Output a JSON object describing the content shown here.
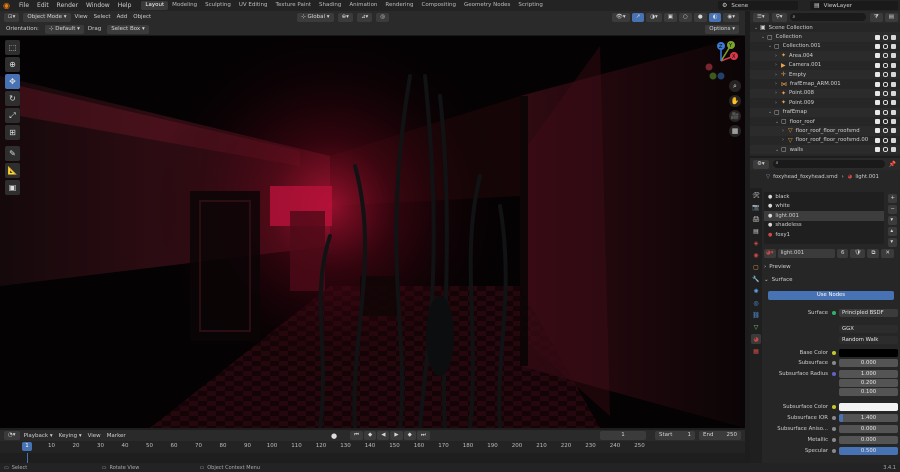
{
  "topbar": {
    "menus": [
      "File",
      "Edit",
      "Render",
      "Window",
      "Help"
    ],
    "workspaces": [
      "Layout",
      "Modeling",
      "Sculpting",
      "UV Editing",
      "Texture Paint",
      "Shading",
      "Animation",
      "Rendering",
      "Compositing",
      "Geometry Nodes",
      "Scripting"
    ],
    "active_workspace": "Layout",
    "scene": "Scene",
    "view_layer": "ViewLayer"
  },
  "viewport_header": {
    "mode": "Object Mode",
    "menus": [
      "View",
      "Select",
      "Add",
      "Object"
    ],
    "transform": "Global",
    "orientation_label": "Orientation:",
    "orientation_value": "Default",
    "drag_label": "Drag",
    "drag_value": "Select Box",
    "options": "Options"
  },
  "gizmo": {
    "x": "X",
    "y": "Y",
    "z": "Z"
  },
  "timeline": {
    "menus": [
      "Playback",
      "Keying",
      "View",
      "Marker"
    ],
    "current_frame": "1",
    "start_label": "Start",
    "start": "1",
    "end_label": "End",
    "end": "250",
    "ticks": [
      "0",
      "10",
      "20",
      "30",
      "40",
      "50",
      "60",
      "70",
      "80",
      "90",
      "100",
      "110",
      "120",
      "130",
      "140",
      "150",
      "160",
      "170",
      "180",
      "190",
      "200",
      "210",
      "220",
      "230",
      "240",
      "250"
    ],
    "playhead": "1"
  },
  "statusbar": {
    "select": "Select",
    "rotate": "Rotate View",
    "context": "Object Context Menu",
    "version": "3.4.1"
  },
  "outliner": {
    "search_placeholder": "",
    "rows": [
      {
        "label": "Scene Collection",
        "indent": 0,
        "icon": "scene",
        "color": "#d0d0d0"
      },
      {
        "label": "Collection",
        "indent": 1,
        "icon": "collection",
        "color": "#d0d0d0"
      },
      {
        "label": "Collection.001",
        "indent": 2,
        "icon": "collection",
        "color": "#d0d0d0"
      },
      {
        "label": "Area.004",
        "indent": 3,
        "icon": "light",
        "color": "#e8a14a"
      },
      {
        "label": "Camera.001",
        "indent": 3,
        "icon": "camera",
        "color": "#e8a14a"
      },
      {
        "label": "Empty",
        "indent": 3,
        "icon": "empty",
        "color": "#e8a14a"
      },
      {
        "label": "frafEmap_ARM.001",
        "indent": 3,
        "icon": "armature",
        "color": "#e8a14a"
      },
      {
        "label": "Point.008",
        "indent": 3,
        "icon": "light",
        "color": "#e8a14a"
      },
      {
        "label": "Point.009",
        "indent": 3,
        "icon": "light",
        "color": "#e8a14a"
      },
      {
        "label": "frafEmap",
        "indent": 2,
        "icon": "collection",
        "color": "#d0d0d0"
      },
      {
        "label": "floor_roof",
        "indent": 3,
        "icon": "collection",
        "color": "#d0d0d0"
      },
      {
        "label": "floor_roof_floor_roofsmd",
        "indent": 4,
        "icon": "mesh",
        "color": "#e8a14a"
      },
      {
        "label": "floor_roof_floor_roofsmd.00",
        "indent": 4,
        "icon": "mesh",
        "color": "#e8a14a"
      },
      {
        "label": "walls",
        "indent": 3,
        "icon": "collection",
        "color": "#d0d0d0"
      }
    ]
  },
  "properties": {
    "breadcrumb_object": "foxyhead_foxyhead.smd",
    "breadcrumb_material": "light.001",
    "materials": [
      "black",
      "white",
      "light.001",
      "shadeless",
      "foxy1"
    ],
    "active_material": "light.001",
    "material_name": "light.001",
    "user_count": "6",
    "preview_label": "Preview",
    "surface_label": "Surface",
    "use_nodes": "Use Nodes",
    "fields": {
      "surface_label": "Surface",
      "surface_value": "Principled BSDF",
      "distribution": "GGX",
      "subsurface_method": "Random Walk",
      "base_color_label": "Base Color",
      "subsurface_label": "Subsurface",
      "subsurface_value": "0.000",
      "subsurface_radius_label": "Subsurface Radius",
      "radius_1": "1.000",
      "radius_2": "0.200",
      "radius_3": "0.100",
      "subsurface_color_label": "Subsurface Color",
      "subsurface_ior_label": "Subsurface IOR",
      "subsurface_ior_value": "1.400",
      "subsurface_aniso_label": "Subsurface Aniso...",
      "subsurface_aniso_value": "0.000",
      "metallic_label": "Metallic",
      "metallic_value": "0.000",
      "specular_label": "Specular",
      "specular_value": "0.500"
    }
  },
  "colors": {
    "accent": "#4772b3",
    "scene_red": "#c3143a"
  }
}
